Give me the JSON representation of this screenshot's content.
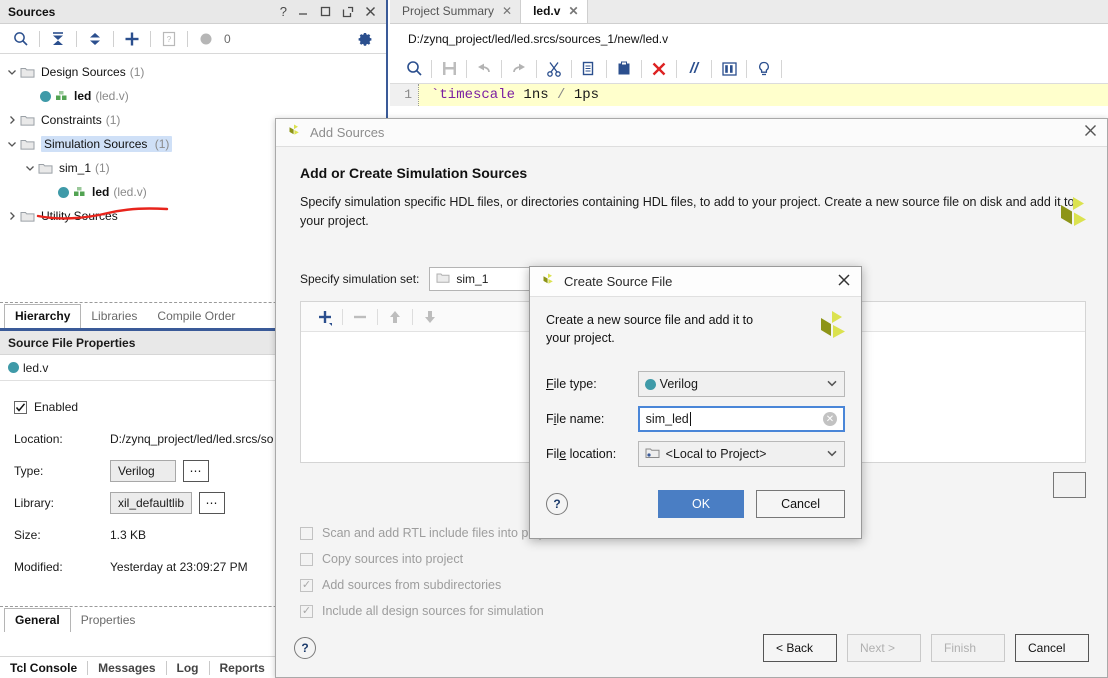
{
  "sources_panel": {
    "title": "Sources",
    "titlebar_buttons": [
      {
        "name": "help-icon",
        "glyph": "?"
      },
      {
        "name": "minimize-icon",
        "glyph": "—"
      },
      {
        "name": "maximize-icon",
        "glyph": "□"
      },
      {
        "name": "float-icon",
        "glyph": "↗"
      },
      {
        "name": "close-icon",
        "glyph": "✕"
      }
    ],
    "toolbar": {
      "search_icon": "search-icon",
      "collapse_icon": "collapse-all-icon",
      "expand_icon": "expand-all-icon",
      "add_icon": "add-sources-icon",
      "report_icon": "report-icon",
      "badge_value": "0",
      "settings_icon": "gear-icon"
    },
    "tree": [
      {
        "label": "Design Sources",
        "count": "(1)",
        "indent": 0,
        "twisty": "∨",
        "kind": "folder"
      },
      {
        "label": "led",
        "sub": "(led.v)",
        "indent": 2,
        "twisty": "",
        "kind": "module"
      },
      {
        "label": "Constraints",
        "count": "(1)",
        "indent": 0,
        "twisty": ">",
        "kind": "folder"
      },
      {
        "label": "Simulation Sources",
        "count": "(1)",
        "indent": 0,
        "twisty": "∨",
        "kind": "folder",
        "selected": true
      },
      {
        "label": "sim_1",
        "count": "(1)",
        "indent": 1,
        "twisty": "∨",
        "kind": "folder"
      },
      {
        "label": "led",
        "sub": "(led.v)",
        "indent": 3,
        "twisty": "",
        "kind": "module"
      },
      {
        "label": "Utility Sources",
        "count": "",
        "indent": 0,
        "twisty": ">",
        "kind": "folder"
      }
    ],
    "tabs": [
      {
        "label": "Hierarchy",
        "active": true
      },
      {
        "label": "Libraries",
        "active": false
      },
      {
        "label": "Compile Order",
        "active": false
      }
    ],
    "annotation": {
      "name": "red-underline-annotation",
      "color": "#e8241c"
    }
  },
  "source_file_properties": {
    "header": "Source File Properties",
    "file_name": "led.v",
    "enabled_label": "Enabled",
    "enabled_checked": true,
    "rows": [
      {
        "label": "Location:",
        "value": "D:/zynq_project/led/led.srcs/so",
        "type": "text"
      },
      {
        "label": "Type:",
        "value": "Verilog",
        "type": "field"
      },
      {
        "label": "Library:",
        "value": "xil_defaultlib",
        "type": "field"
      },
      {
        "label": "Size:",
        "value": "1.3 KB",
        "type": "text"
      },
      {
        "label": "Modified:",
        "value": "Yesterday at 23:09:27 PM",
        "type": "text"
      }
    ],
    "tabs": [
      {
        "label": "General",
        "active": true
      },
      {
        "label": "Properties",
        "active": false
      }
    ],
    "bottom_tabs": [
      {
        "label": "Tcl Console"
      },
      {
        "label": "Messages"
      },
      {
        "label": "Log"
      },
      {
        "label": "Reports"
      }
    ]
  },
  "editor": {
    "tabs": [
      {
        "label": "Project Summary",
        "active": false,
        "closable": true
      },
      {
        "label": "led.v",
        "active": true,
        "closable": true
      }
    ],
    "path": "D:/zynq_project/led/led.srcs/sources_1/new/led.v",
    "toolbar_icons": [
      {
        "name": "search-icon",
        "enabled": true
      },
      {
        "name": "save-icon",
        "enabled": false
      },
      {
        "name": "undo-icon",
        "enabled": false
      },
      {
        "name": "redo-icon",
        "enabled": false
      },
      {
        "name": "cut-icon",
        "enabled": true
      },
      {
        "name": "copy-icon",
        "enabled": true
      },
      {
        "name": "paste-icon",
        "enabled": true
      },
      {
        "name": "delete-icon",
        "enabled": true
      },
      {
        "name": "comment-icon",
        "enabled": true
      },
      {
        "name": "columns-icon",
        "enabled": true
      },
      {
        "name": "bulb-icon",
        "enabled": true
      }
    ],
    "code": {
      "line_number": "1",
      "directive": "`timescale",
      "value_a": "1ns",
      "separator": "/",
      "value_b": "1ps"
    }
  },
  "add_sources_dialog": {
    "title": "Add Sources",
    "close_glyph": "✕",
    "heading": "Add or Create Simulation Sources",
    "description": "Specify simulation specific HDL files, or directories containing HDL files, to add to your project. Create a new source file on disk and add it to your project.",
    "simset_label": "Specify simulation set:",
    "simset_value": "sim_1",
    "list_toolbar": [
      {
        "name": "add-file-icon",
        "enabled": true,
        "glyph": "+"
      },
      {
        "name": "remove-file-icon",
        "enabled": false,
        "glyph": "−"
      },
      {
        "name": "move-up-icon",
        "enabled": false,
        "glyph": "↑"
      },
      {
        "name": "move-down-icon",
        "enabled": false,
        "glyph": "↓"
      }
    ],
    "options": [
      {
        "label": "Scan and add RTL include files into project",
        "checked": false,
        "underline": "i"
      },
      {
        "label": "Copy sources into project",
        "checked": false,
        "underline": "s"
      },
      {
        "label": "Add sources from subdirectories",
        "checked": true,
        "underline": "u"
      },
      {
        "label": "Include all design sources for simulation",
        "checked": true,
        "underline": ""
      }
    ],
    "help_glyph": "?",
    "buttons": [
      {
        "label": "< Back",
        "enabled": true,
        "name": "back-button"
      },
      {
        "label": "Next >",
        "enabled": false,
        "name": "next-button"
      },
      {
        "label": "Finish",
        "enabled": false,
        "name": "finish-button"
      },
      {
        "label": "Cancel",
        "enabled": true,
        "name": "cancel-button"
      }
    ]
  },
  "create_source_dialog": {
    "title": "Create Source File",
    "close_glyph": "✕",
    "description": "Create a new source file and add it to your project.",
    "file_type_label": "File type:",
    "file_type_value": "Verilog",
    "file_name_label": "File name:",
    "file_name_value": "sim_led",
    "file_name_placeholder": "",
    "file_location_label": "File location:",
    "file_location_value": "<Local to Project>",
    "help_glyph": "?",
    "ok_label": "OK",
    "cancel_label": "Cancel"
  },
  "colors": {
    "accent_blue": "#3a5a98",
    "ok_button": "#4a7ec4",
    "focus_border": "#4a86d8",
    "selection": "#cfe0f7",
    "annotation_red": "#e8241c",
    "verilog_dot": "#3f9aa8",
    "logo_light": "#d8e04a",
    "logo_dark": "#8a9114",
    "code_bg": "#ffffcc",
    "keyword_purple": "#7b1fa2"
  }
}
